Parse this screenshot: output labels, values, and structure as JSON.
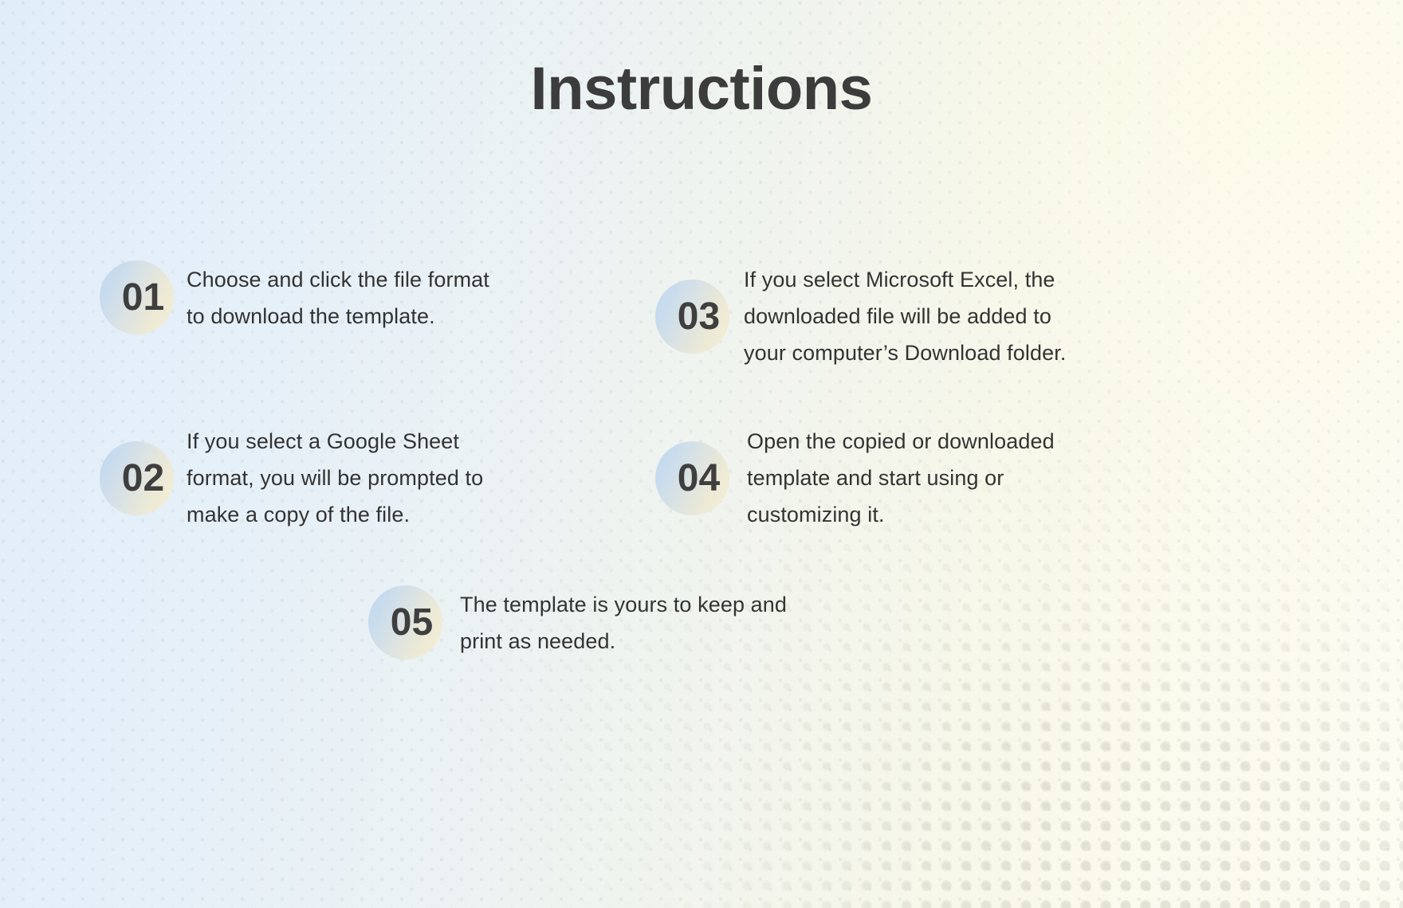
{
  "page": {
    "title": "Instructions",
    "background": {
      "left_color": "#e2edfa",
      "right_color": "#fdfcf3",
      "pattern": "halftone-dots"
    },
    "text_color": "#333333",
    "title_color": "#3c3c3c",
    "badge_gradient_start": "#bcd8ef",
    "badge_gradient_end": "#f6efd4"
  },
  "steps": [
    {
      "number": "01",
      "text": "Choose and click the file format\nto download the template."
    },
    {
      "number": "02",
      "text": "If you select a Google Sheet\nformat, you will be prompted to\nmake a copy of the file."
    },
    {
      "number": "03",
      "text": "If you select Microsoft Excel, the\ndownloaded file will be added to\nyour computer’s Download  folder."
    },
    {
      "number": "04",
      "text": "Open the copied or downloaded\ntemplate and start using or\ncustomizing it."
    },
    {
      "number": "05",
      "text": "The template is yours to keep and\nprint as needed."
    }
  ]
}
